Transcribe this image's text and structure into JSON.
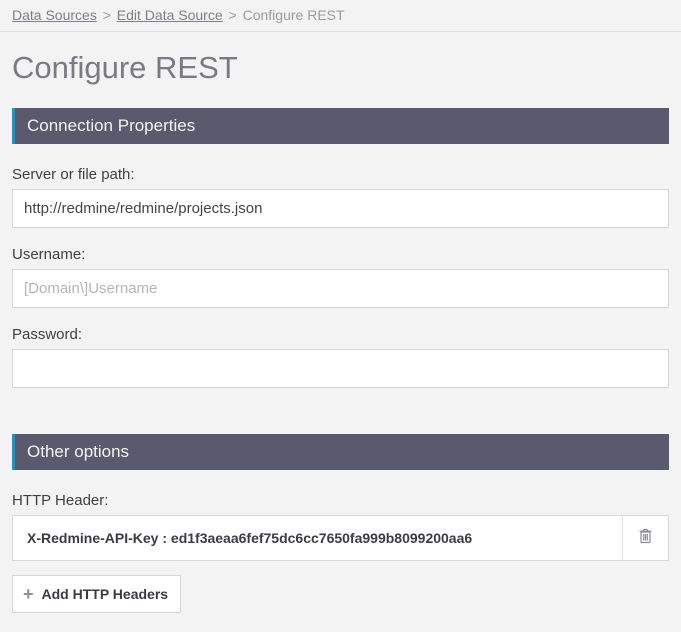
{
  "breadcrumb": {
    "items": [
      {
        "label": "Data Sources",
        "link": true
      },
      {
        "label": "Edit Data Source",
        "link": true
      },
      {
        "label": "Configure REST",
        "link": false
      }
    ],
    "sep": ">"
  },
  "page_title": "Configure REST",
  "sections": {
    "connection": {
      "title": "Connection Properties",
      "server_label": "Server or file path:",
      "server_value": "http://redmine/redmine/projects.json",
      "username_label": "Username:",
      "username_value": "",
      "username_placeholder": "[Domain\\]Username",
      "password_label": "Password:",
      "password_value": ""
    },
    "other": {
      "title": "Other options",
      "http_header_label": "HTTP Header:",
      "headers": [
        {
          "text": "X-Redmine-API-Key : ed1f3aeaa6fef75dc6cc7650fa999b8099200aa6"
        }
      ],
      "add_btn_label": "Add HTTP Headers"
    }
  }
}
